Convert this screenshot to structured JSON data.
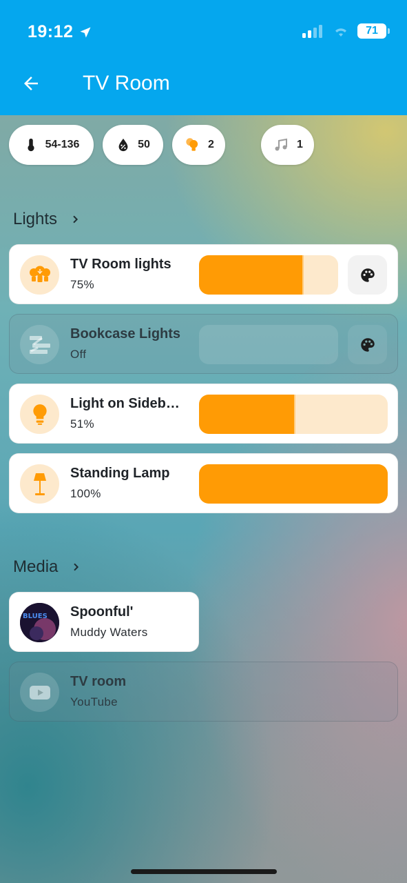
{
  "status_bar": {
    "time": "19:12",
    "battery": "71"
  },
  "header": {
    "title": "TV Room"
  },
  "chips": [
    {
      "icon": "thermometer-icon",
      "value": "54-136"
    },
    {
      "icon": "water-percent-icon",
      "value": "50"
    },
    {
      "icon": "lightbulb-group-icon",
      "value": "2"
    },
    {
      "icon": "music-note-icon",
      "value": "1"
    }
  ],
  "sections": {
    "lights": {
      "title": "Lights"
    },
    "media": {
      "title": "Media"
    }
  },
  "lights": [
    {
      "name": "TV Room lights",
      "state": "75%",
      "brightness": 0.75,
      "on": true,
      "icon": "lightbulb-group-icon"
    },
    {
      "name": "Bookcase Lights",
      "state": "Off",
      "brightness": 0,
      "on": false,
      "icon": "led-strip-icon"
    },
    {
      "name": "Light on Sideb…",
      "state": "51%",
      "brightness": 0.51,
      "on": true,
      "icon": "lightbulb-icon"
    },
    {
      "name": "Standing Lamp",
      "state": "100%",
      "brightness": 1.0,
      "on": true,
      "icon": "floor-lamp-icon"
    }
  ],
  "media": [
    {
      "title": "Spoonful'",
      "subtitle": "Muddy Waters",
      "active": true,
      "art": "album-art",
      "art_text": "BLUES"
    },
    {
      "title": "TV room",
      "subtitle": "YouTube",
      "active": false,
      "icon": "youtube-icon"
    }
  ],
  "colors": {
    "header": "#05a7ee",
    "accent_orange": "#ff9b05",
    "slider_track": "#fde9cc"
  }
}
